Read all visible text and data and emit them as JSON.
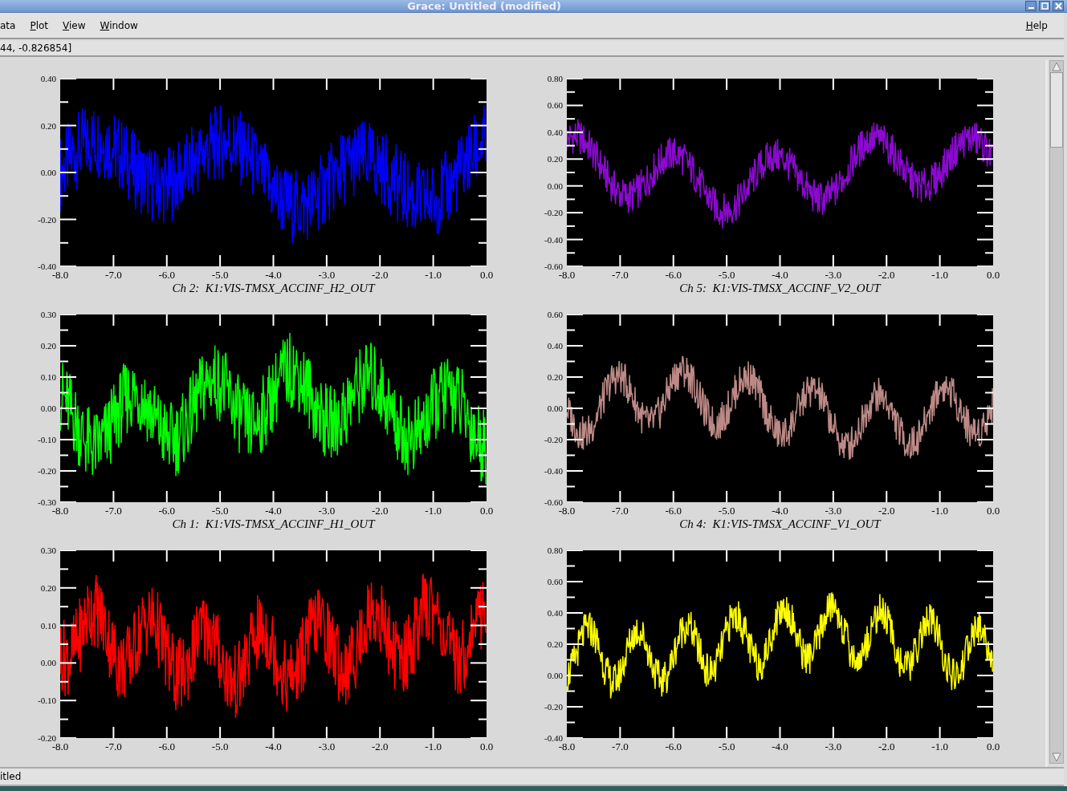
{
  "window": {
    "title": "Grace: Untitled (modified)"
  },
  "menu": [
    {
      "label": "ata",
      "mnemonic": false
    },
    {
      "label": "Plot",
      "mnemonic": true
    },
    {
      "label": "View",
      "mnemonic": true
    },
    {
      "label": "Window",
      "mnemonic": true
    }
  ],
  "help_menu": {
    "label": "Help",
    "mnemonic": true
  },
  "locator": "44, -0.826854]",
  "plots": [
    {
      "color": "#0000ff",
      "yticks": [
        "0.40",
        "0.20",
        "0.00",
        "-0.20",
        "-0.40"
      ],
      "xticks": [
        "-8.0",
        "-7.0",
        "-6.0",
        "-5.0",
        "-4.0",
        "-3.0",
        "-2.0",
        "-1.0",
        "0.0"
      ],
      "title": "Ch 2:  K1:VIS-TMSX_ACCINF_H2_OUT"
    },
    {
      "color": "#8a0ad0",
      "yticks": [
        "0.80",
        "0.60",
        "0.40",
        "0.20",
        "0.00",
        "-0.20",
        "-0.40",
        "-0.60"
      ],
      "xticks": [
        "-8.0",
        "-7.0",
        "-6.0",
        "-5.0",
        "-4.0",
        "-3.0",
        "-2.0",
        "-1.0",
        "0.0"
      ],
      "title": "Ch 5:  K1:VIS-TMSX_ACCINF_V2_OUT"
    },
    {
      "color": "#00ff00",
      "yticks": [
        "0.30",
        "0.20",
        "0.10",
        "0.00",
        "-0.10",
        "-0.20",
        "-0.30"
      ],
      "xticks": [
        "-8.0",
        "-7.0",
        "-6.0",
        "-5.0",
        "-4.0",
        "-3.0",
        "-2.0",
        "-1.0",
        "0.0"
      ],
      "title": "Ch 1:  K1:VIS-TMSX_ACCINF_H1_OUT"
    },
    {
      "color": "#bc8a86",
      "yticks": [
        "0.60",
        "0.40",
        "0.20",
        "0.00",
        "-0.20",
        "-0.40",
        "-0.60"
      ],
      "xticks": [
        "-8.0",
        "-7.0",
        "-6.0",
        "-5.0",
        "-4.0",
        "-3.0",
        "-2.0",
        "-1.0",
        "0.0"
      ],
      "title": "Ch 4:  K1:VIS-TMSX_ACCINF_V1_OUT"
    },
    {
      "color": "#ff0000",
      "yticks": [
        "0.30",
        "0.20",
        "0.10",
        "0.00",
        "-0.10",
        "-0.20"
      ],
      "xticks": [
        "-8.0",
        "-7.0",
        "-6.0",
        "-5.0",
        "-4.0",
        "-3.0",
        "-2.0",
        "-1.0",
        "0.0"
      ]
    },
    {
      "color": "#ffff00",
      "yticks": [
        "0.80",
        "0.60",
        "0.40",
        "0.20",
        "0.00",
        "-0.20",
        "-0.40"
      ],
      "xticks": [
        "-8.0",
        "-7.0",
        "-6.0",
        "-5.0",
        "-4.0",
        "-3.0",
        "-2.0",
        "-1.0",
        "0.0"
      ]
    }
  ],
  "status_bar": "itled"
}
